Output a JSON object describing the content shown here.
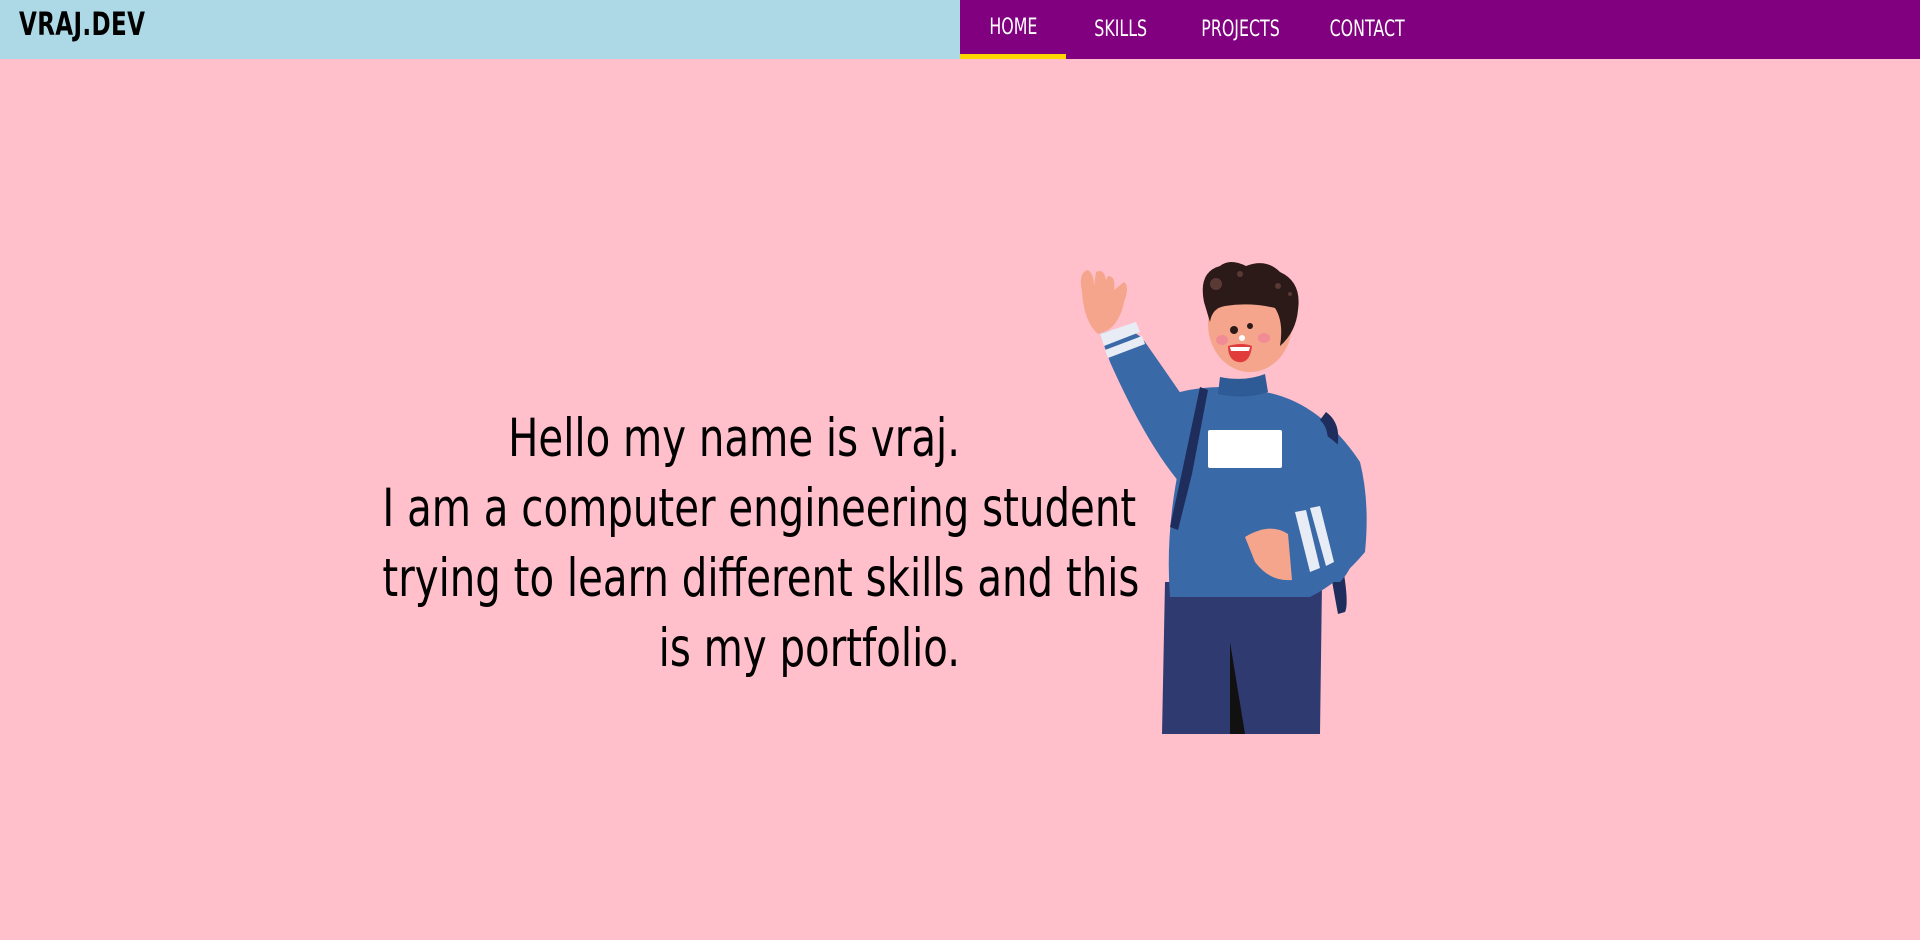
{
  "header": {
    "brand": "VRAJ.DEV",
    "nav": [
      {
        "label": "HOME",
        "active": true
      },
      {
        "label": "SKILLS",
        "active": false
      },
      {
        "label": "PROJECTS",
        "active": false
      },
      {
        "label": "CONTACT",
        "active": false
      }
    ]
  },
  "intro": {
    "lines": [
      "Hello my name is vraj.",
      "I am a computer engineering student",
      "trying to learn different skills and this",
      "is my portfolio."
    ]
  },
  "illustration": {
    "icon": "waving-student-illustration"
  },
  "colors": {
    "background": "#ffc0cb",
    "brand_bg": "#add8e6",
    "nav_bg": "#800080",
    "active_underline": "#ffd700"
  }
}
